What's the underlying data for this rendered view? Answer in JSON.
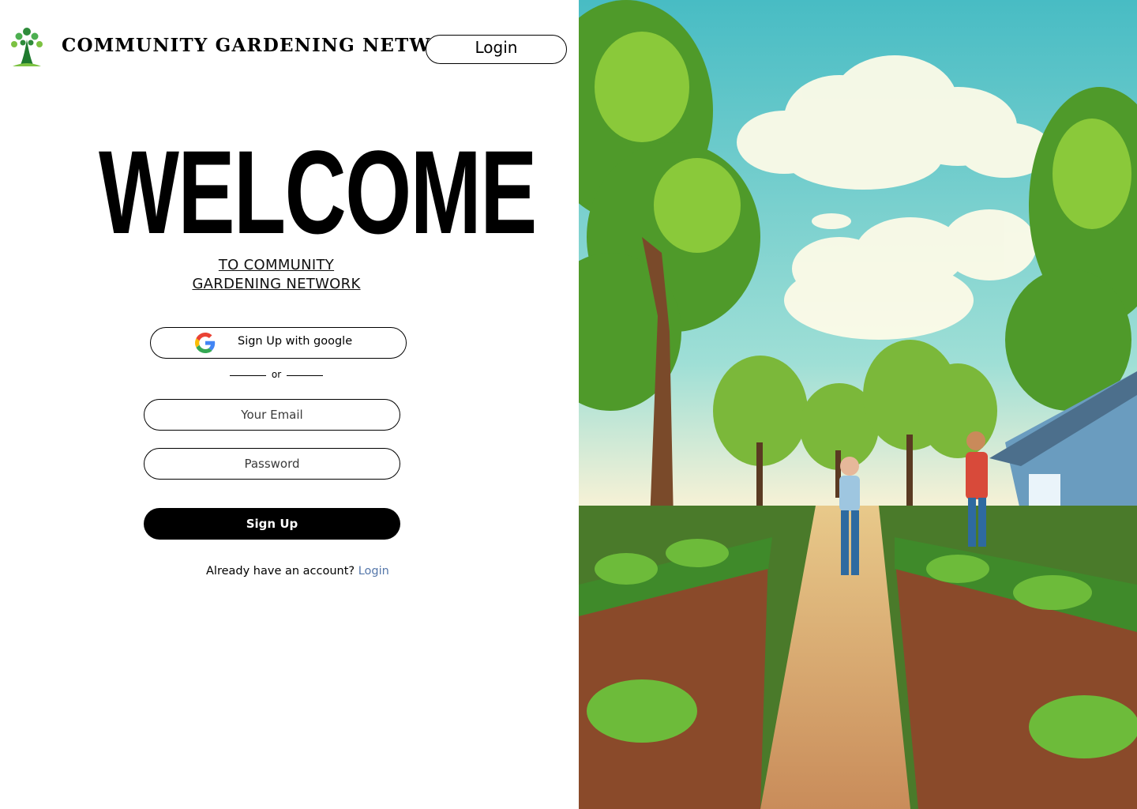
{
  "header": {
    "brand": "COMMUNITY GARDENING NETWORK",
    "login_label": "Login"
  },
  "hero": {
    "title": "WELCOME",
    "subtitle_line1": "TO COMMUNITY",
    "subtitle_line2": "GARDENING NETWORK"
  },
  "form": {
    "google_label": "Sign Up with google",
    "divider_text": "or",
    "email_placeholder": "Your Email",
    "password_placeholder": "Password",
    "signup_label": "Sign Up",
    "already_text": "Already have an account?",
    "login_link": "Login"
  },
  "colors": {
    "primary": "#000000",
    "link": "#5577aa",
    "logo_green": "#3a9a3a",
    "sky": "#5ec8c8"
  },
  "icons": {
    "logo": "tree-people-logo",
    "google": "google-g-icon"
  }
}
